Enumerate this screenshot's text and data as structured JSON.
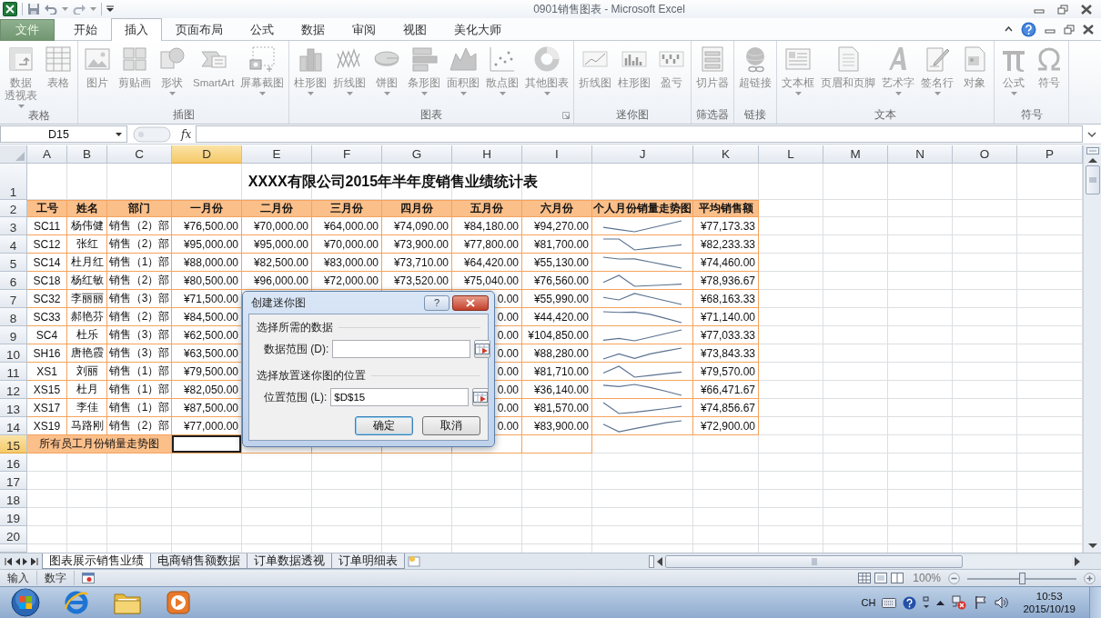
{
  "window": {
    "title": "0901销售图表 - Microsoft Excel"
  },
  "ribbon_tabs": [
    {
      "label": "文件",
      "kind": "file",
      "selected": false
    },
    {
      "label": "开始",
      "kind": "tab",
      "selected": false
    },
    {
      "label": "插入",
      "kind": "tab",
      "selected": true
    },
    {
      "label": "页面布局",
      "kind": "tab",
      "selected": false
    },
    {
      "label": "公式",
      "kind": "tab",
      "selected": false
    },
    {
      "label": "数据",
      "kind": "tab",
      "selected": false
    },
    {
      "label": "审阅",
      "kind": "tab",
      "selected": false
    },
    {
      "label": "视图",
      "kind": "tab",
      "selected": false
    },
    {
      "label": "美化大师",
      "kind": "tab",
      "selected": false
    }
  ],
  "ribbon": {
    "disabled": true,
    "groups": [
      {
        "label": "表格",
        "buttons": [
          {
            "lines": [
              "数据",
              "透视表"
            ],
            "dropdown": true
          },
          {
            "label": "表格",
            "dropdown": false
          }
        ]
      },
      {
        "label": "插图",
        "buttons": [
          {
            "label": "图片",
            "dropdown": false
          },
          {
            "label": "剪贴画",
            "dropdown": false
          },
          {
            "label": "形状",
            "dropdown": true
          },
          {
            "label": "SmartArt",
            "dropdown": false
          },
          {
            "label": "屏幕截图",
            "dropdown": true
          }
        ]
      },
      {
        "label": "图表",
        "launcher": true,
        "buttons": [
          {
            "label": "柱形图",
            "dropdown": true
          },
          {
            "label": "折线图",
            "dropdown": true
          },
          {
            "label": "饼图",
            "dropdown": true
          },
          {
            "label": "条形图",
            "dropdown": true
          },
          {
            "label": "面积图",
            "dropdown": true
          },
          {
            "label": "散点图",
            "dropdown": true
          },
          {
            "label": "其他图表",
            "dropdown": true
          }
        ]
      },
      {
        "label": "迷你图",
        "buttons": [
          {
            "label": "折线图",
            "dropdown": false
          },
          {
            "label": "柱形图",
            "dropdown": false
          },
          {
            "label": "盈亏",
            "dropdown": false
          }
        ]
      },
      {
        "label": "筛选器",
        "buttons": [
          {
            "label": "切片器",
            "dropdown": false
          }
        ]
      },
      {
        "label": "链接",
        "buttons": [
          {
            "label": "超链接",
            "dropdown": false
          }
        ]
      },
      {
        "label": "文本",
        "buttons": [
          {
            "label": "文本框",
            "dropdown": true
          },
          {
            "label": "页眉和页脚",
            "dropdown": false
          },
          {
            "label": "艺术字",
            "dropdown": true
          },
          {
            "label": "签名行",
            "dropdown": true
          },
          {
            "label": "对象",
            "dropdown": false
          }
        ]
      },
      {
        "label": "符号",
        "buttons": [
          {
            "label": "公式",
            "dropdown": true
          },
          {
            "label": "符号",
            "dropdown": false
          }
        ]
      }
    ]
  },
  "formula_bar": {
    "name_box": "D15",
    "fx": "fx"
  },
  "sheet": {
    "title": "XXXX有限公司2015年半年度销售业绩统计表",
    "columns": [
      {
        "label": "A",
        "selected": false
      },
      {
        "label": "B",
        "selected": false
      },
      {
        "label": "C",
        "selected": false
      },
      {
        "label": "D",
        "selected": true
      },
      {
        "label": "E",
        "selected": false
      },
      {
        "label": "F",
        "selected": false
      },
      {
        "label": "G",
        "selected": false
      },
      {
        "label": "H",
        "selected": false
      },
      {
        "label": "I",
        "selected": false
      },
      {
        "label": "J",
        "selected": false
      },
      {
        "label": "K",
        "selected": false
      },
      {
        "label": "L",
        "selected": false
      },
      {
        "label": "M",
        "selected": false
      },
      {
        "label": "N",
        "selected": false
      },
      {
        "label": "O",
        "selected": false
      },
      {
        "label": "P",
        "selected": false
      }
    ],
    "row_numbers": [
      {
        "label": "1",
        "selected": false
      },
      {
        "label": "2",
        "selected": false
      },
      {
        "label": "3",
        "selected": false
      },
      {
        "label": "4",
        "selected": false
      },
      {
        "label": "5",
        "selected": false
      },
      {
        "label": "6",
        "selected": false
      },
      {
        "label": "7",
        "selected": false
      },
      {
        "label": "8",
        "selected": false
      },
      {
        "label": "9",
        "selected": false
      },
      {
        "label": "10",
        "selected": false
      },
      {
        "label": "11",
        "selected": false
      },
      {
        "label": "12",
        "selected": false
      },
      {
        "label": "13",
        "selected": false
      },
      {
        "label": "14",
        "selected": false
      },
      {
        "label": "15",
        "selected": true
      },
      {
        "label": "16",
        "selected": false
      },
      {
        "label": "17",
        "selected": false
      },
      {
        "label": "18",
        "selected": false
      },
      {
        "label": "19",
        "selected": false
      },
      {
        "label": "20",
        "selected": false
      }
    ],
    "header": [
      "工号",
      "姓名",
      "部门",
      "一月份",
      "二月份",
      "三月份",
      "四月份",
      "五月份",
      "六月份",
      "个人月份销量走势图",
      "平均销售额"
    ],
    "rows": [
      {
        "id": "SC11",
        "name": "杨伟健",
        "dept": "销售（2）部",
        "months": {
          "D": "¥76,500.00",
          "E": "¥70,000.00",
          "F": "¥64,000.00",
          "G": "¥74,090.00",
          "H": "¥84,180.00",
          "I": "¥94,270.00"
        },
        "average": "¥77,173.33"
      },
      {
        "id": "SC12",
        "name": "张红",
        "dept": "销售（2）部",
        "months": {
          "D": "¥95,000.00",
          "E": "¥95,000.00",
          "F": "¥70,000.00",
          "G": "¥73,900.00",
          "H": "¥77,800.00",
          "I": "¥81,700.00"
        },
        "average": "¥82,233.33"
      },
      {
        "id": "SC14",
        "name": "杜月红",
        "dept": "销售（1）部",
        "months": {
          "D": "¥88,000.00",
          "E": "¥82,500.00",
          "F": "¥83,000.00",
          "G": "¥73,710.00",
          "H": "¥64,420.00",
          "I": "¥55,130.00"
        },
        "average": "¥74,460.00"
      },
      {
        "id": "SC18",
        "name": "杨红敏",
        "dept": "销售（2）部",
        "months": {
          "D": "¥80,500.00",
          "E": "¥96,000.00",
          "F": "¥72,000.00",
          "G": "¥73,520.00",
          "H": "¥75,040.00",
          "I": "¥76,560.00"
        },
        "average": "¥78,936.67"
      },
      {
        "id": "SC32",
        "name": "李丽丽",
        "dept": "销售（3）部",
        "months": {
          "D": "¥71,500.00",
          "H": "0.00",
          "I": "¥55,990.00"
        },
        "average": "¥68,163.33"
      },
      {
        "id": "SC33",
        "name": "郝艳芬",
        "dept": "销售（2）部",
        "months": {
          "D": "¥84,500.00",
          "H": "0.00",
          "I": "¥44,420.00"
        },
        "average": "¥71,140.00"
      },
      {
        "id": "SC4",
        "name": "杜乐",
        "dept": "销售（3）部",
        "months": {
          "D": "¥62,500.00",
          "H": "0.00",
          "I": "¥104,850.00"
        },
        "average": "¥77,033.33"
      },
      {
        "id": "SH16",
        "name": "唐艳霞",
        "dept": "销售（3）部",
        "months": {
          "D": "¥63,500.00",
          "H": "0.00",
          "I": "¥88,280.00"
        },
        "average": "¥73,843.33"
      },
      {
        "id": "XS1",
        "name": "刘丽",
        "dept": "销售（1）部",
        "months": {
          "D": "¥79,500.00",
          "H": "0.00",
          "I": "¥81,710.00"
        },
        "average": "¥79,570.00"
      },
      {
        "id": "XS15",
        "name": "杜月",
        "dept": "销售（1）部",
        "months": {
          "D": "¥82,050.00",
          "H": "0.00",
          "I": "¥36,140.00"
        },
        "average": "¥66,471.67"
      },
      {
        "id": "XS17",
        "name": "李佳",
        "dept": "销售（1）部",
        "months": {
          "D": "¥87,500.00",
          "H": "0.00",
          "I": "¥81,570.00"
        },
        "average": "¥74,856.67"
      },
      {
        "id": "XS19",
        "name": "马路刚",
        "dept": "销售（2）部",
        "months": {
          "D": "¥77,000.00",
          "H": "0.00",
          "I": "¥83,900.00"
        },
        "average": "¥72,900.00"
      }
    ],
    "summary_label": "所有员工月份销量走势图"
  },
  "dialog": {
    "title": "创建迷你图",
    "help": "?",
    "sections": [
      {
        "heading": "选择所需的数据",
        "field": {
          "label": "数据范围 (D):"
        }
      },
      {
        "heading": "选择放置迷你图的位置",
        "field": {
          "label": "位置范围 (L):",
          "value": "$D$15"
        }
      }
    ],
    "buttons": [
      {
        "label": "确定",
        "kind": "default"
      },
      {
        "label": "取消",
        "kind": "normal"
      }
    ]
  },
  "sheet_tabs": [
    {
      "label": "图表展示销售业绩",
      "selected": true
    },
    {
      "label": "电商销售额数据",
      "selected": false
    },
    {
      "label": "订单数据透视",
      "selected": false
    },
    {
      "label": "订单明细表",
      "selected": false
    }
  ],
  "status_bar": {
    "mode": "输入",
    "indicator": "数字",
    "zoom": "100%",
    "zoom_slider": {
      "level": 0.5
    }
  },
  "taskbar": {
    "language": "CH",
    "time": "10:53",
    "date": "2015/10/19"
  }
}
